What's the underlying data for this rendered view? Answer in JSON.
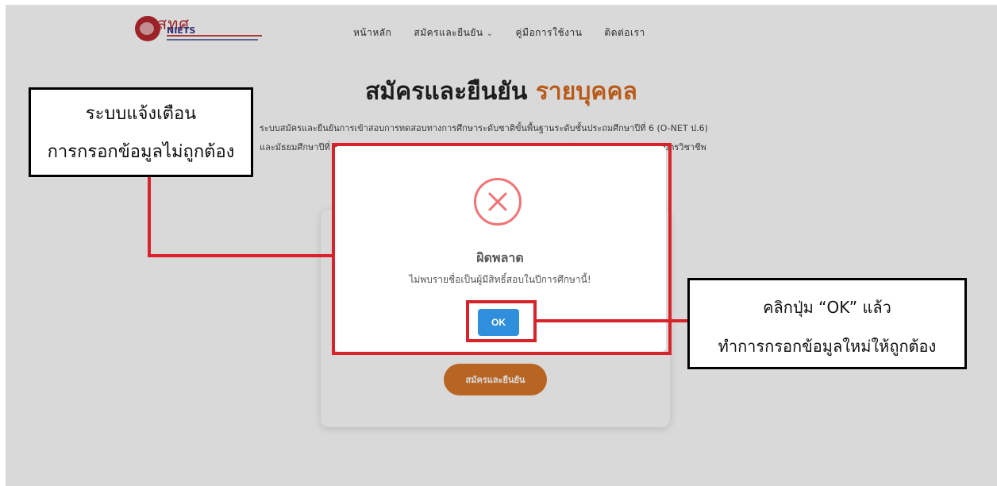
{
  "logo": {
    "thai": "สทศ",
    "en": "NIETS"
  },
  "nav": {
    "items": [
      "หน้าหลัก",
      "สมัครและยืนยัน",
      "คู่มือการใช้งาน",
      "ติดต่อเรา"
    ]
  },
  "page": {
    "title": "สมัครและยืนยัน",
    "title_highlight": "รายบุคคล",
    "desc_line1": "ระบบสมัครและยืนยันการเข้าสอบการทดสอบทางการศึกษาระดับชาติขั้นพื้นฐานระดับชั้นประถมศึกษาปีที่ 6 (O-NET ป.6)",
    "desc_line2": "และมัธยมศึกษาปีที่ 3 (O-NET ม.3) และการทดสอบทางการศึกษาระดับชาติด้านอาชีวศึกษาระดับประกาศนียบัตรวิชาชีพ",
    "submit_label": "สมัครและยืนยัน"
  },
  "modal": {
    "title": "ผิดพลาด",
    "message": "ไม่พบรายชื่อเป็นผู้มีสิทธิ์สอบในปีการศึกษานี้!",
    "ok_label": "OK",
    "icon": "error-x-icon"
  },
  "annotations": {
    "left_line1": "ระบบแจ้งเตือน",
    "left_line2": "การกรอกข้อมูลไม่ถูกต้อง",
    "right_line1": "คลิกปุ่ม “OK” แล้ว",
    "right_line2": "ทำการกรอกข้อมูลใหม่ให้ถูกต้อง"
  },
  "colors": {
    "accent": "#d96b1f",
    "annotation_red": "#d9232a",
    "ok_button": "#2f8fdc",
    "error_icon": "#f27474"
  }
}
